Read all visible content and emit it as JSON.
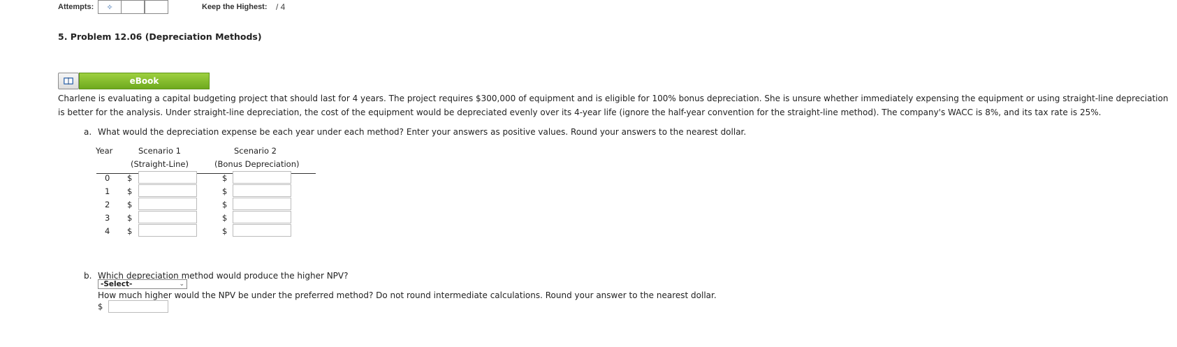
{
  "header": {
    "attempts_label": "Attempts:",
    "keep_label": "Keep the Highest:",
    "keep_value": "/ 4"
  },
  "problem": {
    "title": "5.  Problem 12.06 (Depreciation Methods)",
    "ebook_label": "eBook",
    "paragraph": "Charlene is evaluating a capital budgeting project that should last for 4 years. The project requires $300,000 of equipment and is eligible for 100% bonus depreciation. She is unsure whether immediately expensing the equipment or using straight-line depreciation is better for the analysis. Under straight-line depreciation, the cost of the equipment would be depreciated evenly over its 4-year life (ignore the half-year convention for the straight-line method). The company's WACC is 8%, and its tax rate is 25%."
  },
  "part_a": {
    "marker": "a.",
    "question": "What would the depreciation expense be each year under each method? Enter your answers as positive values. Round your answers to the nearest dollar.",
    "col_year": "Year",
    "col1_line1": "Scenario 1",
    "col1_line2": "(Straight-Line)",
    "col2_line1": "Scenario 2",
    "col2_line2": "(Bonus Depreciation)",
    "currency": "$",
    "rows": [
      {
        "year": "0",
        "s1": "",
        "s2": ""
      },
      {
        "year": "1",
        "s1": "",
        "s2": ""
      },
      {
        "year": "2",
        "s1": "",
        "s2": ""
      },
      {
        "year": "3",
        "s1": "",
        "s2": ""
      },
      {
        "year": "4",
        "s1": "",
        "s2": ""
      }
    ]
  },
  "part_b": {
    "marker": "b.",
    "question": "Which depreciation method would produce the higher NPV?",
    "select_value": "-Select-",
    "question2": "How much higher would the NPV be under the preferred method? Do not round intermediate calculations. Round your answer to the nearest dollar.",
    "currency": "$",
    "npv_value": ""
  }
}
